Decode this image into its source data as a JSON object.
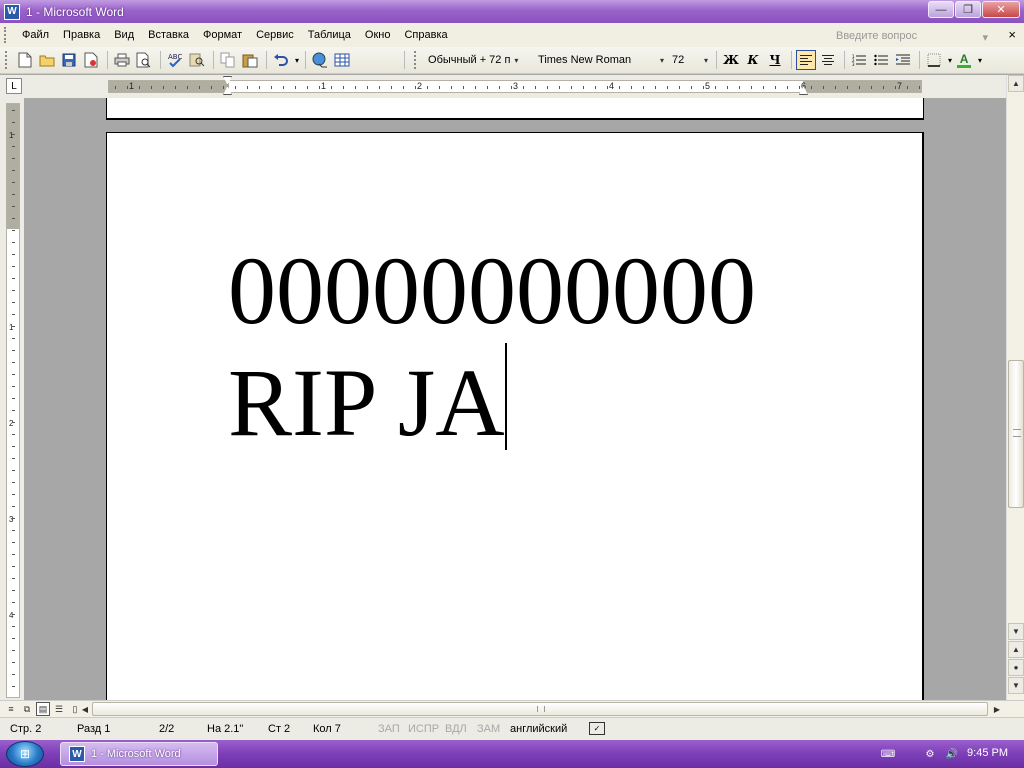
{
  "window": {
    "title": "1 - Microsoft Word",
    "app_icon": "W",
    "controls": {
      "minimize": "—",
      "restore": "❐",
      "close": "✕"
    }
  },
  "menu": {
    "items": [
      "Файл",
      "Правка",
      "Вид",
      "Вставка",
      "Формат",
      "Сервис",
      "Таблица",
      "Окно",
      "Справка"
    ],
    "help_placeholder": "Введите вопрос",
    "doc_close": "×"
  },
  "toolbar": {
    "icons": [
      "new-document",
      "open-folder",
      "save",
      "permission",
      "print",
      "print-preview",
      "spelling",
      "research",
      "copy",
      "paste",
      "undo",
      "hyperlink",
      "insert-table"
    ],
    "style_value": "Обычный + 72 п",
    "font_value": "Times New Roman",
    "size_value": "72",
    "bold_label": "Ж",
    "italic_label": "К",
    "underline_label": "Ч",
    "align_left_active": true,
    "font_color": "#ff0000",
    "font_color_letter": "A",
    "highlight_color": "#ffff00"
  },
  "ruler": {
    "tab_symbol": "L",
    "horizontal_numbers": [
      "1",
      "1",
      "2",
      "3",
      "4",
      "5",
      "6",
      "7"
    ],
    "vertical_numbers": [
      "1",
      "1",
      "2",
      "3",
      "4"
    ]
  },
  "document": {
    "line1": "00000000000",
    "line2": "RIP JA"
  },
  "status": {
    "page": "Стр. 2",
    "section": "Разд 1",
    "pages": "2/2",
    "at": "На 2.1\"",
    "line": "Ст 2",
    "col": "Кол 7",
    "rec": "ЗАП",
    "trk": "ИСПР",
    "ext": "ВДЛ",
    "ovr": "ЗАМ",
    "language": "английский"
  },
  "taskbar": {
    "task_label": "1 - Microsoft Word",
    "time": "9:45 PM"
  }
}
